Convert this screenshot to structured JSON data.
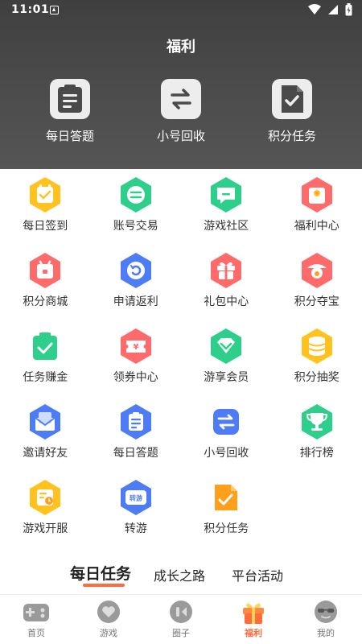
{
  "status": {
    "time": "11:01"
  },
  "header": {
    "title": "福利"
  },
  "quick": [
    {
      "label": "每日答题",
      "icon": "clipboard-icon"
    },
    {
      "label": "小号回收",
      "icon": "exchange-icon"
    },
    {
      "label": "积分任务",
      "icon": "document-check-icon"
    }
  ],
  "grid": [
    {
      "label": "每日签到",
      "icon": "calendar-check-icon",
      "color": "#ffc21f"
    },
    {
      "label": "账号交易",
      "icon": "exchange-icon",
      "color": "#2ecf8a"
    },
    {
      "label": "游戏社区",
      "icon": "chat-icon",
      "color": "#2ecf8a"
    },
    {
      "label": "福利中心",
      "icon": "gift-bag-icon",
      "color": "#ff6b6b"
    },
    {
      "label": "积分商城",
      "icon": "shop-icon",
      "color": "#ff6b6b"
    },
    {
      "label": "申请返利",
      "icon": "refund-icon",
      "color": "#4e7cf6"
    },
    {
      "label": "礼包中心",
      "icon": "gift-box-icon",
      "color": "#ff6b6b"
    },
    {
      "label": "积分夺宝",
      "icon": "treasure-icon",
      "color": "#ff6b6b"
    },
    {
      "label": "任务赚金",
      "icon": "task-bag-icon",
      "color": "#2ecf8a"
    },
    {
      "label": "领券中心",
      "icon": "coupon-icon",
      "color": "#ff6b6b"
    },
    {
      "label": "游享会员",
      "icon": "member-icon",
      "color": "#2ecf8a"
    },
    {
      "label": "积分抽奖",
      "icon": "coins-icon",
      "color": "#ffc21f"
    },
    {
      "label": "邀请好友",
      "icon": "envelope-icon",
      "color": "#4e7cf6"
    },
    {
      "label": "每日答题",
      "icon": "clipboard-icon",
      "color": "#4e7cf6"
    },
    {
      "label": "小号回收",
      "icon": "exchange-icon",
      "color": "#4e7cf6"
    },
    {
      "label": "排行榜",
      "icon": "trophy-icon",
      "color": "#2ecf8a"
    },
    {
      "label": "游戏开服",
      "icon": "server-clock-icon",
      "color": "#ffc21f"
    },
    {
      "label": "转游",
      "icon": "transfer-game-icon",
      "color": "#4e7cf6",
      "badge": "转游"
    },
    {
      "label": "积分任务",
      "icon": "document-check-icon",
      "color": "#ff9f1c"
    }
  ],
  "tabs": [
    {
      "label": "每日任务"
    },
    {
      "label": "成长之路"
    },
    {
      "label": "平台活动"
    }
  ],
  "nav": [
    {
      "label": "首页",
      "icon": "gamepad-icon"
    },
    {
      "label": "游戏",
      "icon": "heart-bubble-icon"
    },
    {
      "label": "圈子",
      "icon": "circle-chat-icon"
    },
    {
      "label": "福利",
      "icon": "gift-icon"
    },
    {
      "label": "我的",
      "icon": "sunglasses-face-icon"
    }
  ],
  "colors": {
    "accent": "#ff6b3d",
    "header": "#4a4a4a"
  }
}
